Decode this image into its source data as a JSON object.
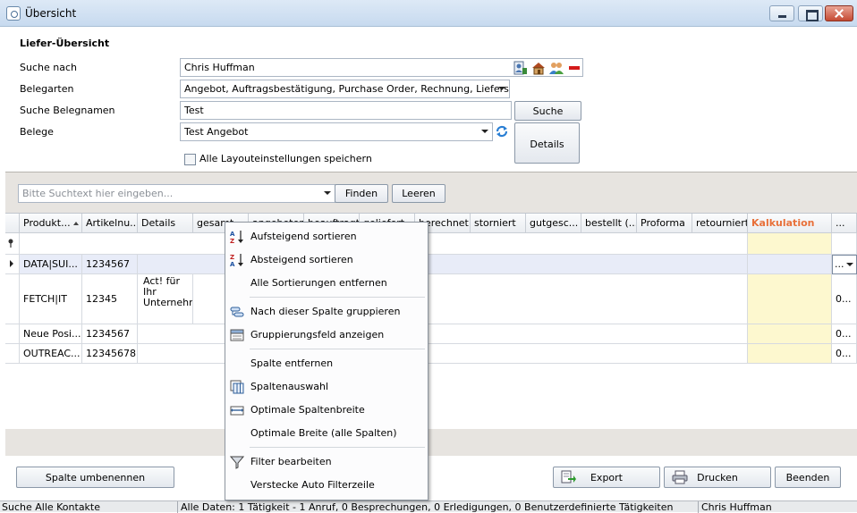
{
  "window": {
    "title": "Übersicht"
  },
  "form": {
    "heading": "Liefer-Übersicht",
    "search_by_label": "Suche nach",
    "search_by_value": "Chris Huffman",
    "doc_types_label": "Belegarten",
    "doc_types_value": "Angebot, Auftragsbestätigung, Purchase Order, Rechnung, Lieferschein",
    "doc_name_label": "Suche Belegnamen",
    "doc_name_value": "Test",
    "docs_label": "Belege",
    "docs_value": "Test Angebot",
    "search_button": "Suche",
    "details_button": "Details",
    "save_layout_label": "Alle Layouteinstellungen speichern"
  },
  "toolbar": {
    "search_placeholder": "Bitte Suchtext hier eingeben...",
    "find_button": "Finden",
    "clear_button": "Leeren"
  },
  "grid": {
    "columns": [
      "Produkt...",
      "Artikelnu...",
      "Details",
      "gesamt",
      "angeboten",
      "beauftragt",
      "geliefert",
      "berechnet",
      "storniert",
      "gutgesc...",
      "bestellt (...",
      "Proforma",
      "retourniert",
      "Kalkulation",
      "..."
    ],
    "rows": [
      {
        "product": "DATA|SUI...",
        "article": "1234567",
        "details": "",
        "last": "..."
      },
      {
        "product": "FETCH|IT",
        "article": "12345",
        "details": "Act! für Ihr Unternehmen",
        "last": "0..."
      },
      {
        "product": "Neue Posi...",
        "article": "1234567",
        "details": "",
        "last": "0..."
      },
      {
        "product": "OUTREAC...",
        "article": "12345678",
        "details": "",
        "last": "0..."
      }
    ]
  },
  "context_menu": {
    "items": [
      "Aufsteigend sortieren",
      "Absteigend sortieren",
      "Alle Sortierungen entfernen",
      "Nach dieser Spalte gruppieren",
      "Gruppierungsfeld anzeigen",
      "Spalte entfernen",
      "Spaltenauswahl",
      "Optimale Spaltenbreite",
      "Optimale Breite (alle Spalten)",
      "Filter bearbeiten",
      "Verstecke Auto Filterzeile"
    ]
  },
  "bottom": {
    "rename_column": "Spalte umbenennen",
    "export": "Export",
    "print": "Drucken",
    "close": "Beenden"
  },
  "status": {
    "left": "Suche Alle Kontakte",
    "middle": "Alle Daten: 1 Tätigkeit - 1 Anruf, 0 Besprechungen, 0 Erledigungen, 0 Benutzerdefinierte Tätigkeiten",
    "right": "Chris Huffman"
  },
  "colors": {
    "kalkulation_header": "#e8703a",
    "kalkulation_column": "#fdf8cf",
    "selected_row": "#e8ecf8"
  }
}
